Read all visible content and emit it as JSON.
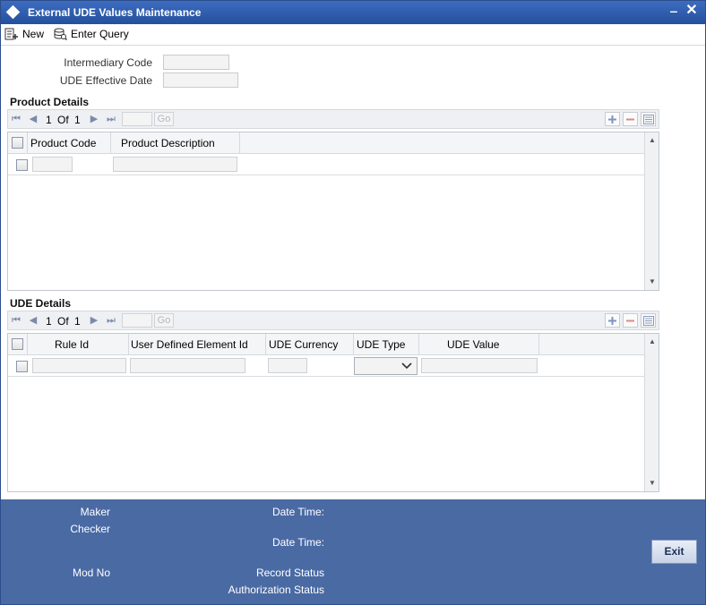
{
  "window": {
    "title": "External UDE Values Maintenance",
    "minimize_label": "▬",
    "close_label": "✕"
  },
  "toolbar": {
    "new_label": "New",
    "enter_query_label": "Enter Query"
  },
  "form": {
    "intermediary_code_label": "Intermediary Code",
    "intermediary_code_value": "",
    "ude_effective_date_label": "UDE Effective Date",
    "ude_effective_date_value": ""
  },
  "product_details": {
    "title": "Product Details",
    "nav": {
      "current": "1",
      "of_label": "Of",
      "total": "1",
      "go_label": "Go"
    },
    "columns": [
      "Product Code",
      "Product Description"
    ],
    "rows": [
      {
        "product_code": "",
        "product_description": ""
      }
    ]
  },
  "ude_details": {
    "title": "UDE Details",
    "nav": {
      "current": "1",
      "of_label": "Of",
      "total": "1",
      "go_label": "Go"
    },
    "columns": [
      "Rule Id",
      "User Defined Element Id",
      "UDE Currency",
      "UDE Type",
      "UDE Value"
    ],
    "rows": [
      {
        "rule_id": "",
        "user_defined_element_id": "",
        "ude_currency": "",
        "ude_type": "",
        "ude_value": ""
      }
    ]
  },
  "footer": {
    "maker_label": "Maker",
    "checker_label": "Checker",
    "date_time_label_1": "Date Time:",
    "date_time_label_2": "Date Time:",
    "mod_no_label": "Mod No",
    "record_status_label": "Record Status",
    "authorization_status_label": "Authorization Status",
    "exit_label": "Exit"
  },
  "colors": {
    "title_bar": "#24509c",
    "footer_bg": "#4a6aa4",
    "grid_header": "#f4f5f7"
  }
}
